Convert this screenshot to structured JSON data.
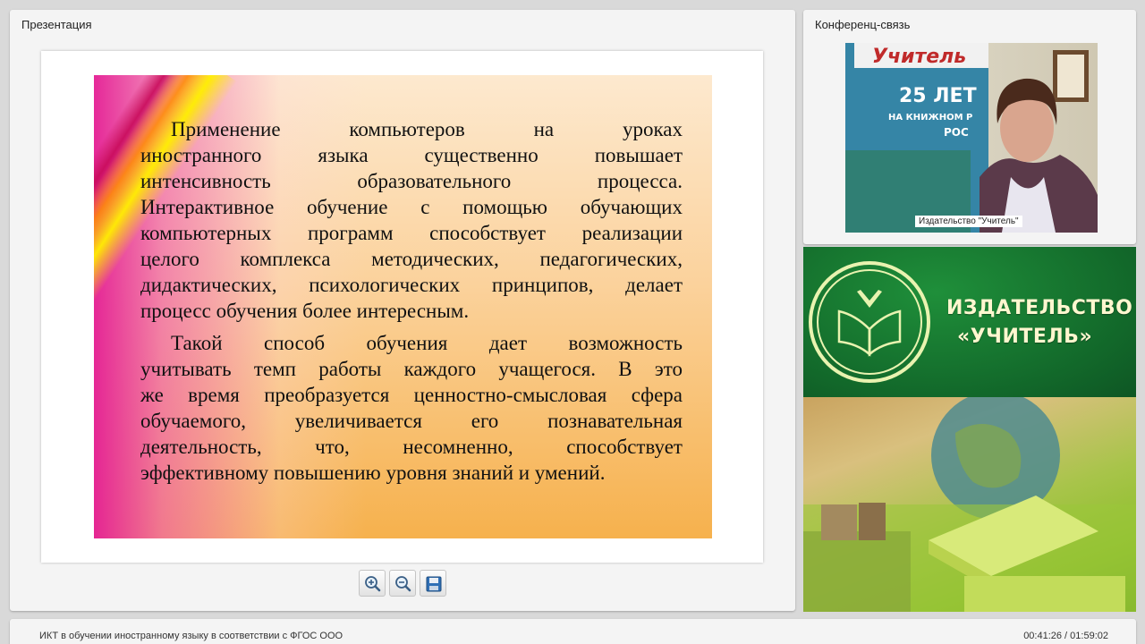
{
  "presentation": {
    "title": "Презентация",
    "slide": {
      "paragraph1": [
        "Применение компьютеров на уроках",
        "иностранного языка существенно повышает",
        "интенсивность образовательного процесса.",
        "Интерактивное обучение с помощью обучающих",
        "компьютерных программ способствует реализации",
        "целого комплекса методических, педагогических,",
        "дидактических, психологических принципов, делает",
        "процесс обучения более интересным."
      ],
      "paragraph2": [
        "Такой способ обучения дает возможность",
        "учитывать темп работы каждого учащегося. В это",
        "же время преобразуется ценностно-смысловая сфера",
        "обучаемого, увеличивается его познавательная",
        "деятельность, что, несомненно, способствует",
        "эффективному повышению уровня знаний и умений."
      ]
    },
    "toolbar": {
      "zoom_in_icon": "magnifier-plus-icon",
      "zoom_out_icon": "magnifier-minus-icon",
      "save_icon": "floppy-disk-icon"
    }
  },
  "conference": {
    "title": "Конференц-связь",
    "video": {
      "speaker_label": "Издательство \"Учитель\"",
      "poster_text": {
        "brand": "Учитель",
        "anniversary": "25 ЛЕТ",
        "line2": "НА КНИЖНОМ Р",
        "line3": "РОС"
      }
    }
  },
  "brand": {
    "line1": "ИЗДАТЕЛЬСТВО",
    "line2": "«УЧИТЕЛЬ»",
    "colors": {
      "green": "#12682a",
      "text": "#fff7cf"
    }
  },
  "status": {
    "lesson_title": "ИКТ в обучении иностранному языку в соответствии с ФГОС ООО",
    "time": "00:41:26 / 01:59:02"
  }
}
